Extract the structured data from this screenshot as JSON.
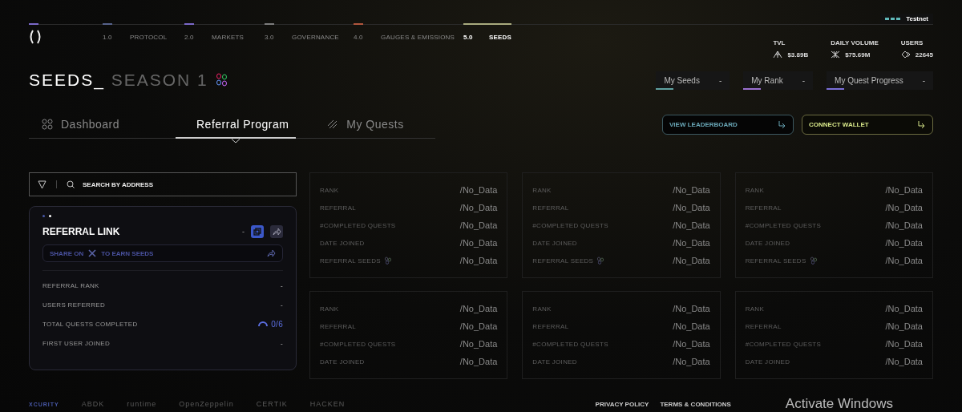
{
  "nav": {
    "items": [
      {
        "number": "1.0",
        "label": "PROTOCOL",
        "color": "#56628a",
        "selected": false
      },
      {
        "number": "2.0",
        "label": "MARKETS",
        "color": "#7a68c8",
        "selected": false
      },
      {
        "number": "3.0",
        "label": "GOVERNANCE",
        "color": "#7c7c7c",
        "selected": false
      },
      {
        "number": "4.0",
        "label": "GAUGES & EMISSIONS",
        "color": "#b0553d",
        "selected": false
      },
      {
        "number": "5.0",
        "label": "SEEDS",
        "color": "#a9ab7e",
        "selected": true
      }
    ]
  },
  "network": {
    "label": "Testnet"
  },
  "stats": [
    {
      "kind": "tvl",
      "label": "TVL",
      "value": "$3.89B"
    },
    {
      "kind": "volume",
      "label": "DAILY VOLUME",
      "value": "$75.69M"
    },
    {
      "kind": "users",
      "label": "USERS",
      "value": "22645"
    }
  ],
  "title": {
    "main": "SEEDS_",
    "sub": "SEASON 1"
  },
  "summary": [
    {
      "label": "My Seeds",
      "value": "-",
      "color": "#5fa0a0"
    },
    {
      "label": "My Rank",
      "value": "-",
      "color": "#9a6fd0"
    },
    {
      "label": "My Quest Progress",
      "value": "-",
      "color": "#7a6fd8"
    }
  ],
  "tabs": [
    {
      "kind": "grid",
      "label": "Dashboard",
      "selected": false
    },
    {
      "kind": "cube",
      "label": "Referral Program",
      "selected": true
    },
    {
      "kind": "slashes",
      "label": "My Quests",
      "selected": false
    }
  ],
  "actions": [
    {
      "kind": "leaderboard",
      "label": "VIEW LEADERBOARD"
    },
    {
      "kind": "wallet",
      "label": "CONNECT WALLET"
    }
  ],
  "search": {
    "placeholder": "SEARCH BY ADDRESS"
  },
  "referral": {
    "dots": [
      {
        "selected": false
      },
      {
        "selected": true
      }
    ],
    "title": "REFERRAL LINK",
    "link": "-",
    "share": {
      "before": "SHARE ON",
      "after": "TO EARN SEEDS"
    },
    "stats": [
      {
        "kind": "plain",
        "label": "REFERRAL RANK",
        "value": "-"
      },
      {
        "kind": "plain",
        "label": "USERS REFERRED",
        "value": "-"
      },
      {
        "kind": "progress",
        "label": "TOTAL QUESTS COMPLETED",
        "value": "0/6"
      },
      {
        "kind": "plain",
        "label": "FIRST USER JOINED",
        "value": "-"
      }
    ]
  },
  "cards": [
    {
      "rows": [
        {
          "kind": "plain",
          "label": "RANK",
          "value": "/No_Data"
        },
        {
          "kind": "plain",
          "label": "REFERRAL",
          "value": "/No_Data"
        },
        {
          "kind": "plain",
          "label": "#COMPLETED QUESTS",
          "value": "/No_Data"
        },
        {
          "kind": "plain",
          "label": "DATE JOINED",
          "value": "/No_Data"
        },
        {
          "kind": "seeds",
          "label": "REFERRAL SEEDS",
          "value": "/No_Data"
        }
      ]
    },
    {
      "rows": [
        {
          "kind": "plain",
          "label": "RANK",
          "value": "/No_Data"
        },
        {
          "kind": "plain",
          "label": "REFERRAL",
          "value": "/No_Data"
        },
        {
          "kind": "plain",
          "label": "#COMPLETED QUESTS",
          "value": "/No_Data"
        },
        {
          "kind": "plain",
          "label": "DATE JOINED",
          "value": "/No_Data"
        },
        {
          "kind": "seeds",
          "label": "REFERRAL SEEDS",
          "value": "/No_Data"
        }
      ]
    },
    {
      "rows": [
        {
          "kind": "plain",
          "label": "RANK",
          "value": "/No_Data"
        },
        {
          "kind": "plain",
          "label": "REFERRAL",
          "value": "/No_Data"
        },
        {
          "kind": "plain",
          "label": "#COMPLETED QUESTS",
          "value": "/No_Data"
        },
        {
          "kind": "plain",
          "label": "DATE JOINED",
          "value": "/No_Data"
        },
        {
          "kind": "seeds",
          "label": "REFERRAL SEEDS",
          "value": "/No_Data"
        }
      ]
    },
    {
      "rows": [
        {
          "kind": "plain",
          "label": "RANK",
          "value": "/No_Data"
        },
        {
          "kind": "plain",
          "label": "REFERRAL",
          "value": "/No_Data"
        },
        {
          "kind": "plain",
          "label": "#COMPLETED QUESTS",
          "value": "/No_Data"
        },
        {
          "kind": "plain",
          "label": "DATE JOINED",
          "value": "/No_Data"
        }
      ]
    },
    {
      "rows": [
        {
          "kind": "plain",
          "label": "RANK",
          "value": "/No_Data"
        },
        {
          "kind": "plain",
          "label": "REFERRAL",
          "value": "/No_Data"
        },
        {
          "kind": "plain",
          "label": "#COMPLETED QUESTS",
          "value": "/No_Data"
        },
        {
          "kind": "plain",
          "label": "DATE JOINED",
          "value": "/No_Data"
        }
      ]
    },
    {
      "rows": [
        {
          "kind": "plain",
          "label": "RANK",
          "value": "/No_Data"
        },
        {
          "kind": "plain",
          "label": "REFERRAL",
          "value": "/No_Data"
        },
        {
          "kind": "plain",
          "label": "#COMPLETED QUESTS",
          "value": "/No_Data"
        },
        {
          "kind": "plain",
          "label": "DATE JOINED",
          "value": "/No_Data"
        }
      ]
    }
  ],
  "footer": {
    "partners": [
      "XCURITY",
      "ABDK",
      "runtime",
      "OpenZeppelin",
      "CERTIK",
      "HACKEN"
    ],
    "links": [
      "PRIVACY POLICY",
      "TERMS & CONDITIONS"
    ]
  },
  "system": {
    "notice": "Activate Windows"
  }
}
